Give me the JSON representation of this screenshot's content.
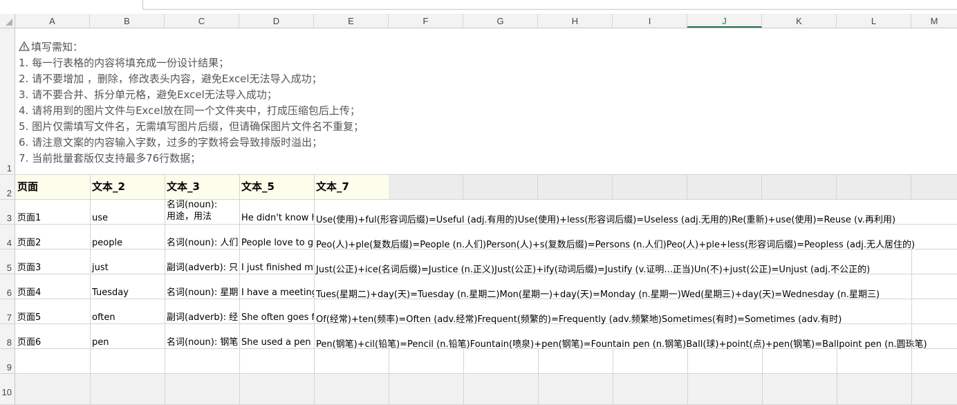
{
  "columns": [
    "A",
    "B",
    "C",
    "D",
    "E",
    "F",
    "G",
    "H",
    "I",
    "J",
    "K",
    "L",
    "M"
  ],
  "selected_column": "J",
  "row_numbers": [
    "1",
    "2",
    "3",
    "4",
    "5",
    "6",
    "7",
    "8",
    "9",
    "10"
  ],
  "notice": {
    "title": "填写需知：",
    "lines": [
      "1. 每一行表格的内容将填充成一份设计结果；",
      "2. 请不要增加 ，删除，修改表头内容，避免Excel无法导入成功；",
      "3. 请不要合并、拆分单元格，避免Excel无法导入成功；",
      "4. 请将用到的图片文件与Excel放在同一个文件夹中，打成压缩包后上传；",
      "5. 图片仅需填写文件名，无需填写图片后缀，但请确保图片文件名不重复；",
      "6. 请注意文案的内容输入字数，过多的字数将会导致排版时溢出；",
      "7. 当前批量套版仅支持最多76行数据；"
    ]
  },
  "headers": [
    "页面",
    "文本_2",
    "文本_3",
    "文本_5",
    "文本_7"
  ],
  "rows": [
    {
      "page": "页面1",
      "t2": "use",
      "t3a": "名词(noun):",
      "t3b": "用途，用法",
      "t5": "He didn't know h",
      "t7": "Use(使用)+ful(形容词后缀)=Useful (adj.有用的)Use(使用)+less(形容词后缀)=Useless (adj.无用的)Re(重新)+use(使用)=Reuse (v.再利用)"
    },
    {
      "page": "页面2",
      "t2": "people",
      "t3": "名词(noun): 人们",
      "t5": "People love to ga",
      "t7": "Peo(人)+ple(复数后缀)=People (n.人们)Person(人)+s(复数后缀)=Persons (n.人们)Peo(人)+ple+less(形容词后缀)=Peopless (adj.无人居住的)"
    },
    {
      "page": "页面3",
      "t2": "just",
      "t3": "副词(adverb): 只",
      "t5": "I just finished my",
      "t7": "Just(公正)+ice(名词后缀)=Justice (n.正义)Just(公正)+ify(动词后缀)=Justify (v.证明...正当)Un(不)+just(公正)=Unjust (adj.不公正的)"
    },
    {
      "page": "页面4",
      "t2": "Tuesday",
      "t3": "名词(noun): 星期",
      "t5": "I have a meeting",
      "t7": "Tues(星期二)+day(天)=Tuesday (n.星期二)Mon(星期一)+day(天)=Monday (n.星期一)Wed(星期三)+day(天)=Wednesday (n.星期三)"
    },
    {
      "page": "页面5",
      "t2": "often",
      "t3": "副词(adverb): 经",
      "t5": "She often goes fo",
      "t7": "Of(经常)+ten(频率)=Often (adv.经常)Frequent(频繁的)=Frequently (adv.频繁地)Sometimes(有时)=Sometimes (adv.有时)"
    },
    {
      "page": "页面6",
      "t2": "pen",
      "t3": "名词(noun): 钢笔",
      "t5": "She used a pen to",
      "t7": "Pen(钢笔)+cil(铅笔)=Pencil (n.铅笔)Fountain(喷泉)+pen(钢笔)=Fountain pen (n.钢笔)Ball(球)+point(点)+pen(钢笔)=Ballpoint pen (n.圆珠笔)"
    }
  ]
}
